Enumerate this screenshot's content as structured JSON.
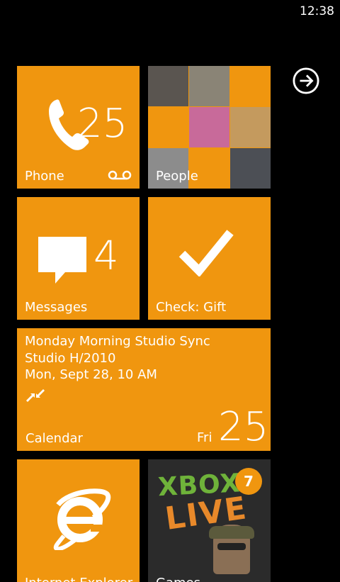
{
  "status": {
    "time": "12:38"
  },
  "tiles": {
    "phone": {
      "label": "Phone",
      "count": "25"
    },
    "people": {
      "label": "People"
    },
    "messages": {
      "label": "Messages",
      "count": "4"
    },
    "check": {
      "label": "Check: Gift"
    },
    "calendar": {
      "title": "Monday Morning Studio Sync",
      "location": "Studio H/2010",
      "when": "Mon, Sept 28, 10 AM",
      "label": "Calendar",
      "day": "Fri",
      "date": "25"
    },
    "ie": {
      "label": "Internet Explorer"
    },
    "games": {
      "label": "Games",
      "badge": "7",
      "logo_line1": "XBOX",
      "logo_line2": "LIVE"
    }
  },
  "colors": {
    "accent": "#f0960f",
    "background": "#000000"
  },
  "icons": {
    "phone": "phone-icon",
    "voicemail": "voicemail-icon",
    "messages": "message-bubble-icon",
    "check": "checkmark-icon",
    "calendar_reminder": "collapse-arrows-icon",
    "ie": "internet-explorer-icon",
    "more": "arrow-right-circle-icon"
  }
}
